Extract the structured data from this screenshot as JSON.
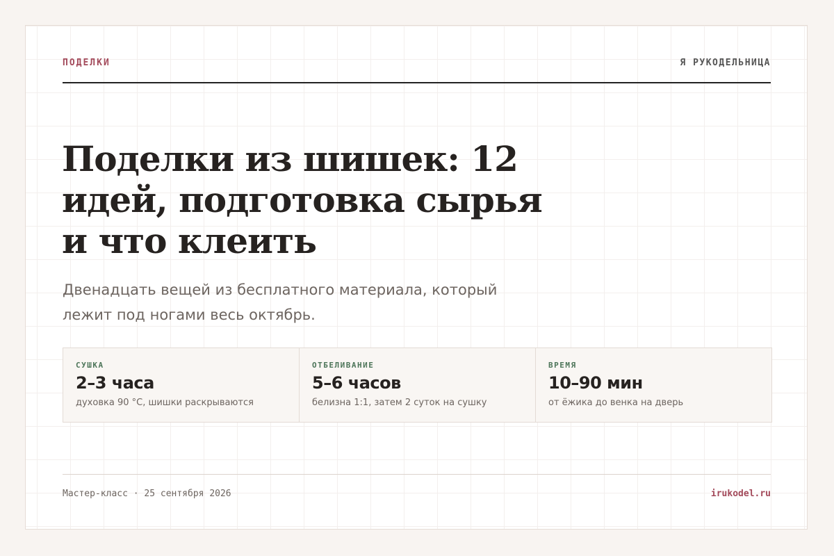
{
  "header": {
    "category": "ПОДЕЛКИ",
    "site_name": "Я РУКОДЕЛЬНИЦА"
  },
  "article": {
    "title": "Поделки из шишек: 12 идей, подготовка сырья и что клеить",
    "subtitle": "Двенадцать вещей из бесплатного материала, который лежит под ногами весь октябрь."
  },
  "stats": [
    {
      "label": "СУШКА",
      "value": "2–3 часа",
      "note": "духовка 90 °C, шишки раскрываются"
    },
    {
      "label": "ОТБЕЛИВАНИЕ",
      "value": "5–6 часов",
      "note": "белизна 1:1, затем 2 суток на сушку"
    },
    {
      "label": "ВРЕМЯ",
      "value": "10–90 мин",
      "note": "от ёжика до венка на дверь"
    }
  ],
  "footer": {
    "meta": "Мастер-класс · 25 сентября 2026",
    "domain": "irukodel.ru"
  },
  "colors": {
    "accent": "#a34a5b",
    "label_green": "#4d7559",
    "text": "#262220",
    "muted": "#6d6560",
    "page_bg": "#f8f4f1"
  }
}
